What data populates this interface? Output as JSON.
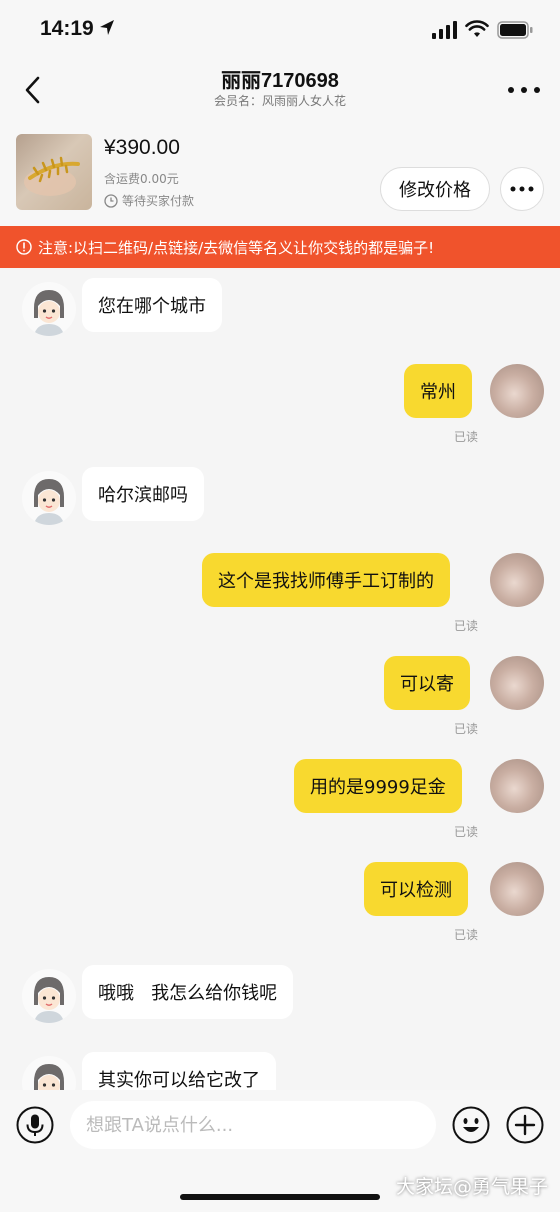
{
  "status_bar": {
    "time": "14:19"
  },
  "nav": {
    "title": "丽丽7170698",
    "subtitle": "会员名：风雨丽人女人花"
  },
  "product": {
    "price": "¥390.00",
    "shipping": "含运费0.00元",
    "status": "等待买家付款",
    "modify_price_label": "修改价格"
  },
  "warning": {
    "text": "注意:以扫二维码/点链接/去微信等名义让你交钱的都是骗子!"
  },
  "messages": [
    {
      "side": "left",
      "text": "您在哪个城市"
    },
    {
      "side": "right",
      "text": "常州",
      "status": "已读"
    },
    {
      "side": "left",
      "text": "哈尔滨邮吗"
    },
    {
      "side": "right",
      "text": "这个是我找师傅手工订制的",
      "status": "已读"
    },
    {
      "side": "right",
      "text": "可以寄",
      "status": "已读"
    },
    {
      "side": "right",
      "text": "用的是9999足金",
      "status": "已读"
    },
    {
      "side": "right",
      "text": "可以检测",
      "status": "已读"
    },
    {
      "side": "left",
      "text": "哦哦   我怎么给你钱呢"
    },
    {
      "side": "left",
      "text": "其实你可以给它改了"
    }
  ],
  "input": {
    "placeholder": "想跟TA说点什么..."
  },
  "watermark": "大家坛@勇气果子",
  "colors": {
    "accent_yellow": "#f8d92f",
    "warning_orange": "#f0532c",
    "background": "#f5f5f5"
  },
  "icons": [
    "location-arrow-icon",
    "signal-icon",
    "wifi-icon",
    "battery-icon",
    "back-chevron-icon",
    "more-dots-icon",
    "clock-icon",
    "warning-circle-icon",
    "microphone-icon",
    "emoji-icon",
    "plus-icon"
  ]
}
